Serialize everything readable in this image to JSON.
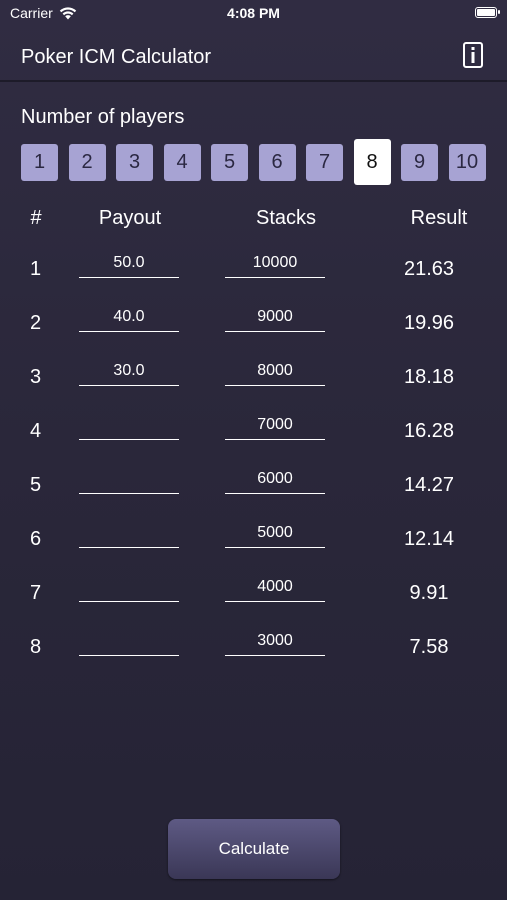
{
  "status_bar": {
    "carrier": "Carrier",
    "time": "4:08 PM"
  },
  "nav": {
    "title": "Poker ICM Calculator",
    "info_icon": "info-icon"
  },
  "players": {
    "label": "Number of players",
    "options": [
      "1",
      "2",
      "3",
      "4",
      "5",
      "6",
      "7",
      "8",
      "9",
      "10"
    ],
    "selected": "8"
  },
  "table": {
    "headers": {
      "num": "#",
      "payout": "Payout",
      "stacks": "Stacks",
      "result": "Result"
    },
    "rows": [
      {
        "num": "1",
        "payout": "50.0",
        "stack": "10000",
        "result": "21.63"
      },
      {
        "num": "2",
        "payout": "40.0",
        "stack": "9000",
        "result": "19.96"
      },
      {
        "num": "3",
        "payout": "30.0",
        "stack": "8000",
        "result": "18.18"
      },
      {
        "num": "4",
        "payout": "",
        "stack": "7000",
        "result": "16.28"
      },
      {
        "num": "5",
        "payout": "",
        "stack": "6000",
        "result": "14.27"
      },
      {
        "num": "6",
        "payout": "",
        "stack": "5000",
        "result": "12.14"
      },
      {
        "num": "7",
        "payout": "",
        "stack": "4000",
        "result": "9.91"
      },
      {
        "num": "8",
        "payout": "",
        "stack": "3000",
        "result": "7.58"
      }
    ]
  },
  "calculate_label": "Calculate",
  "colors": {
    "background": "#2a273a",
    "player_button": "#a7a3d3",
    "player_button_selected": "#ffffff"
  }
}
